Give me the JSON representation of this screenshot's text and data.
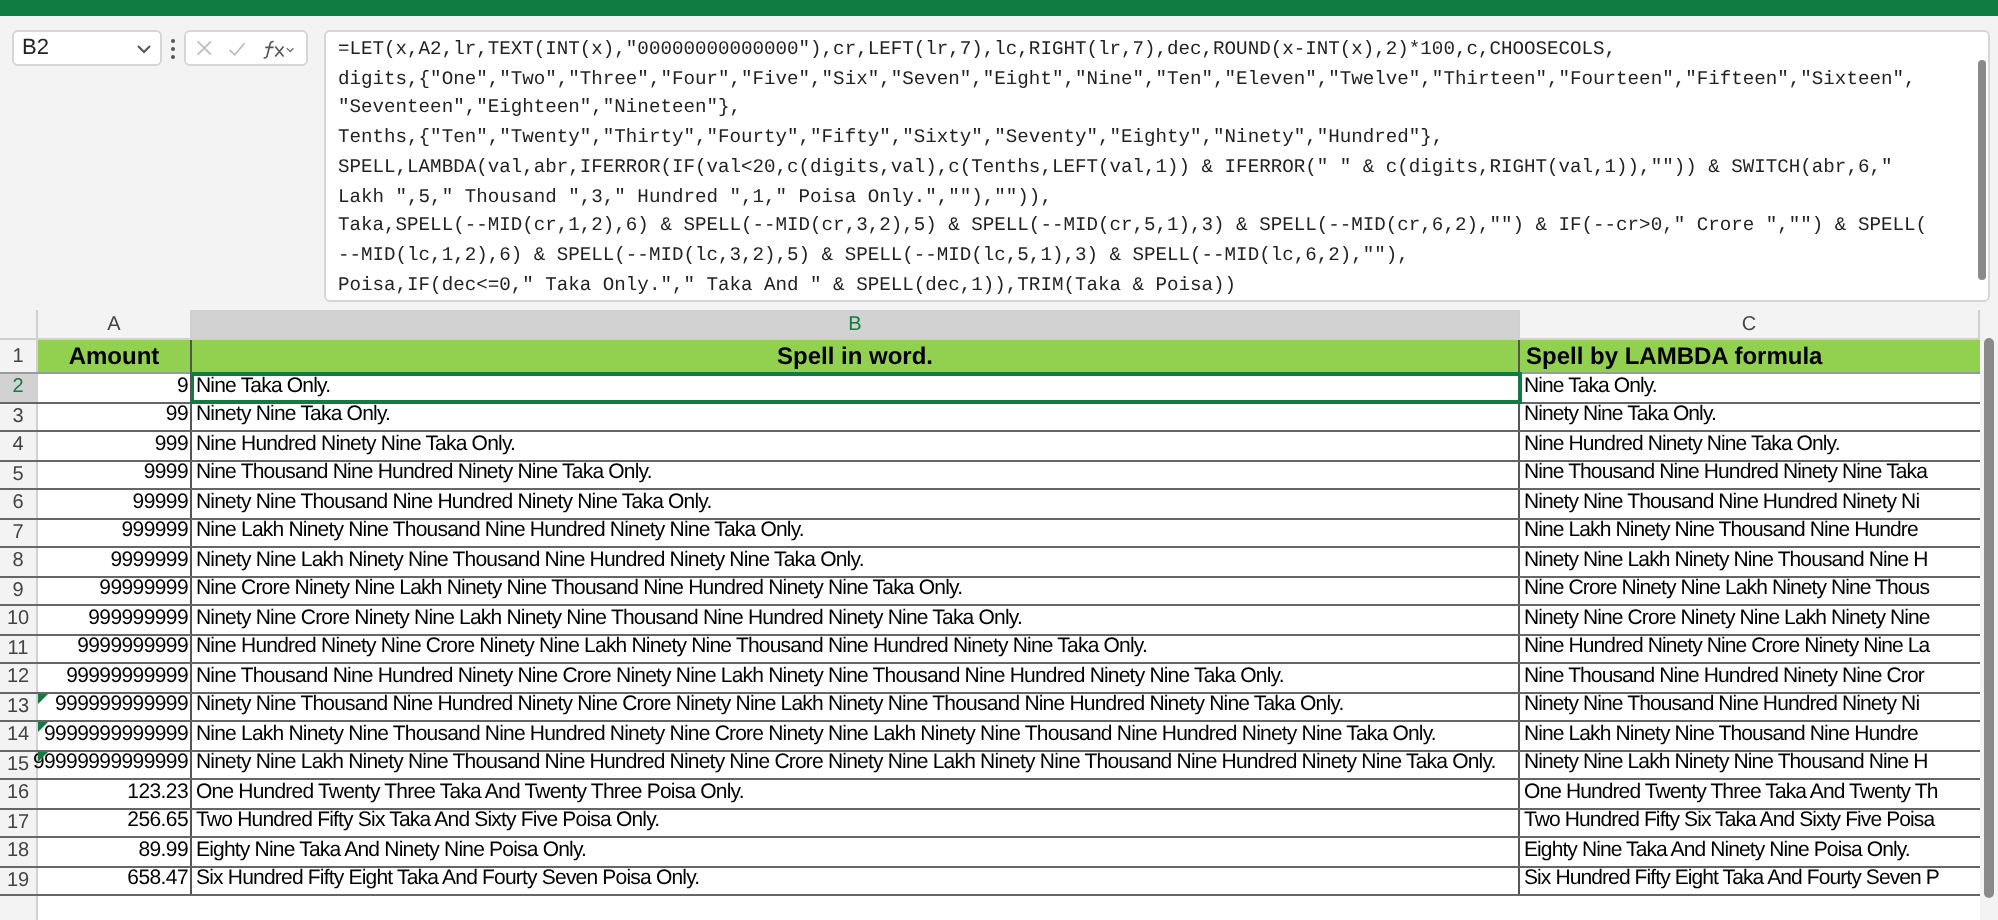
{
  "name_box": "B2",
  "formula_lines": [
    "=LET(x,A2,lr,TEXT(INT(x),\"00000000000000\"),cr,LEFT(lr,7),lc,RIGHT(lr,7),dec,ROUND(x-INT(x),2)*100,c,CHOOSECOLS,",
    "digits,{\"One\",\"Two\",\"Three\",\"Four\",\"Five\",\"Six\",\"Seven\",\"Eight\",\"Nine\",\"Ten\",\"Eleven\",\"Twelve\",\"Thirteen\",\"Fourteen\",\"Fifteen\",\"Sixteen\",",
    "\"Seventeen\",\"Eighteen\",\"Nineteen\"},",
    "Tenths,{\"Ten\",\"Twenty\",\"Thirty\",\"Fourty\",\"Fifty\",\"Sixty\",\"Seventy\",\"Eighty\",\"Ninety\",\"Hundred\"},",
    "SPELL,LAMBDA(val,abr,IFERROR(IF(val<20,c(digits,val),c(Tenths,LEFT(val,1)) & IFERROR(\" \" & c(digits,RIGHT(val,1)),\"\")) & SWITCH(abr,6,\"",
    "Lakh \",5,\" Thousand \",3,\" Hundred \",1,\" Poisa Only.\",\"\"),\"\")),",
    "Taka,SPELL(--MID(cr,1,2),6) & SPELL(--MID(cr,3,2),5) & SPELL(--MID(cr,5,1),3) & SPELL(--MID(cr,6,2),\"\") & IF(--cr>0,\" Crore \",\"\") & SPELL(",
    "--MID(lc,1,2),6) & SPELL(--MID(lc,3,2),5) & SPELL(--MID(lc,5,1),3) & SPELL(--MID(lc,6,2),\"\"),",
    "Poisa,IF(dec<=0,\" Taka Only.\",\" Taka And \" & SPELL(dec,1)),TRIM(Taka & Poisa))"
  ],
  "columns": [
    {
      "label": "A",
      "selected": false
    },
    {
      "label": "B",
      "selected": true
    },
    {
      "label": "C",
      "selected": false
    }
  ],
  "header": {
    "number": "1",
    "amount": "Amount",
    "spell": "Spell in word.",
    "lambda": "Spell by LAMBDA formula"
  },
  "rows": [
    {
      "number": "2",
      "selected": true,
      "error_flag": false,
      "amount": "9",
      "spell": "Nine Taka Only.",
      "lambda": "Nine Taka Only."
    },
    {
      "number": "3",
      "selected": false,
      "error_flag": false,
      "amount": "99",
      "spell": "Ninety Nine Taka Only.",
      "lambda": "Ninety Nine Taka Only."
    },
    {
      "number": "4",
      "selected": false,
      "error_flag": false,
      "amount": "999",
      "spell": "Nine Hundred Ninety Nine Taka Only.",
      "lambda": "Nine Hundred Ninety Nine Taka Only."
    },
    {
      "number": "5",
      "selected": false,
      "error_flag": false,
      "amount": "9999",
      "spell": "Nine Thousand Nine Hundred Ninety Nine Taka Only.",
      "lambda": "Nine Thousand Nine Hundred Ninety Nine Taka"
    },
    {
      "number": "6",
      "selected": false,
      "error_flag": false,
      "amount": "99999",
      "spell": "Ninety Nine Thousand Nine Hundred Ninety Nine Taka Only.",
      "lambda": "Ninety Nine Thousand Nine Hundred Ninety Ni"
    },
    {
      "number": "7",
      "selected": false,
      "error_flag": false,
      "amount": "999999",
      "spell": "Nine Lakh Ninety Nine Thousand Nine Hundred Ninety Nine Taka Only.",
      "lambda": "Nine Lakh Ninety Nine Thousand Nine Hundre"
    },
    {
      "number": "8",
      "selected": false,
      "error_flag": false,
      "amount": "9999999",
      "spell": "Ninety Nine Lakh Ninety Nine Thousand Nine Hundred Ninety Nine Taka Only.",
      "lambda": "Ninety Nine Lakh Ninety Nine Thousand Nine H"
    },
    {
      "number": "9",
      "selected": false,
      "error_flag": false,
      "amount": "99999999",
      "spell": "Nine Crore Ninety Nine Lakh Ninety Nine Thousand Nine Hundred Ninety Nine Taka Only.",
      "lambda": "Nine Crore Ninety Nine Lakh Ninety Nine Thous"
    },
    {
      "number": "10",
      "selected": false,
      "error_flag": false,
      "amount": "999999999",
      "spell": "Ninety Nine Crore Ninety Nine Lakh Ninety Nine Thousand Nine Hundred Ninety Nine Taka Only.",
      "lambda": "Ninety Nine Crore Ninety Nine Lakh Ninety Nine"
    },
    {
      "number": "11",
      "selected": false,
      "error_flag": false,
      "amount": "9999999999",
      "spell": "Nine Hundred Ninety Nine Crore Ninety Nine Lakh Ninety Nine Thousand Nine Hundred Ninety Nine Taka Only.",
      "lambda": "Nine Hundred Ninety Nine Crore Ninety Nine La"
    },
    {
      "number": "12",
      "selected": false,
      "error_flag": false,
      "amount": "99999999999",
      "spell": "Nine Thousand Nine Hundred Ninety Nine Crore Ninety Nine Lakh Ninety Nine Thousand Nine Hundred Ninety Nine Taka Only.",
      "lambda": "Nine Thousand Nine Hundred Ninety Nine Cror"
    },
    {
      "number": "13",
      "selected": false,
      "error_flag": true,
      "amount": "999999999999",
      "spell": "Ninety Nine Thousand Nine Hundred Ninety Nine Crore Ninety Nine Lakh Ninety Nine Thousand Nine Hundred Ninety Nine Taka Only.",
      "lambda": "Ninety Nine Thousand Nine Hundred Ninety Ni"
    },
    {
      "number": "14",
      "selected": false,
      "error_flag": true,
      "amount": "9999999999999",
      "spell": "Nine Lakh Ninety Nine Thousand Nine Hundred Ninety Nine Crore Ninety Nine Lakh Ninety Nine Thousand Nine Hundred Ninety Nine Taka Only.",
      "lambda": "Nine Lakh Ninety Nine Thousand Nine Hundre"
    },
    {
      "number": "15",
      "selected": false,
      "error_flag": true,
      "amount": "99999999999999",
      "spell": "Ninety Nine Lakh Ninety Nine Thousand Nine Hundred Ninety Nine Crore Ninety Nine Lakh Ninety Nine Thousand Nine Hundred Ninety Nine Taka Only.",
      "lambda": "Ninety Nine Lakh Ninety Nine Thousand Nine H"
    },
    {
      "number": "16",
      "selected": false,
      "error_flag": false,
      "amount": "123.23",
      "spell": "One Hundred Twenty Three Taka And Twenty Three Poisa Only.",
      "lambda": "One Hundred Twenty Three Taka And Twenty Th"
    },
    {
      "number": "17",
      "selected": false,
      "error_flag": false,
      "amount": "256.65",
      "spell": "Two Hundred Fifty Six Taka And Sixty Five Poisa Only.",
      "lambda": "Two Hundred Fifty Six Taka And Sixty Five Poisa"
    },
    {
      "number": "18",
      "selected": false,
      "error_flag": false,
      "amount": "89.99",
      "spell": "Eighty Nine Taka And Ninety Nine Poisa Only.",
      "lambda": "Eighty Nine Taka And Ninety Nine Poisa Only."
    },
    {
      "number": "19",
      "selected": false,
      "error_flag": false,
      "amount": "658.47",
      "spell": "Six Hundred Fifty Eight Taka And Fourty Seven Poisa Only.",
      "lambda": "Six Hundred Fifty Eight Taka And Fourty Seven P"
    }
  ]
}
